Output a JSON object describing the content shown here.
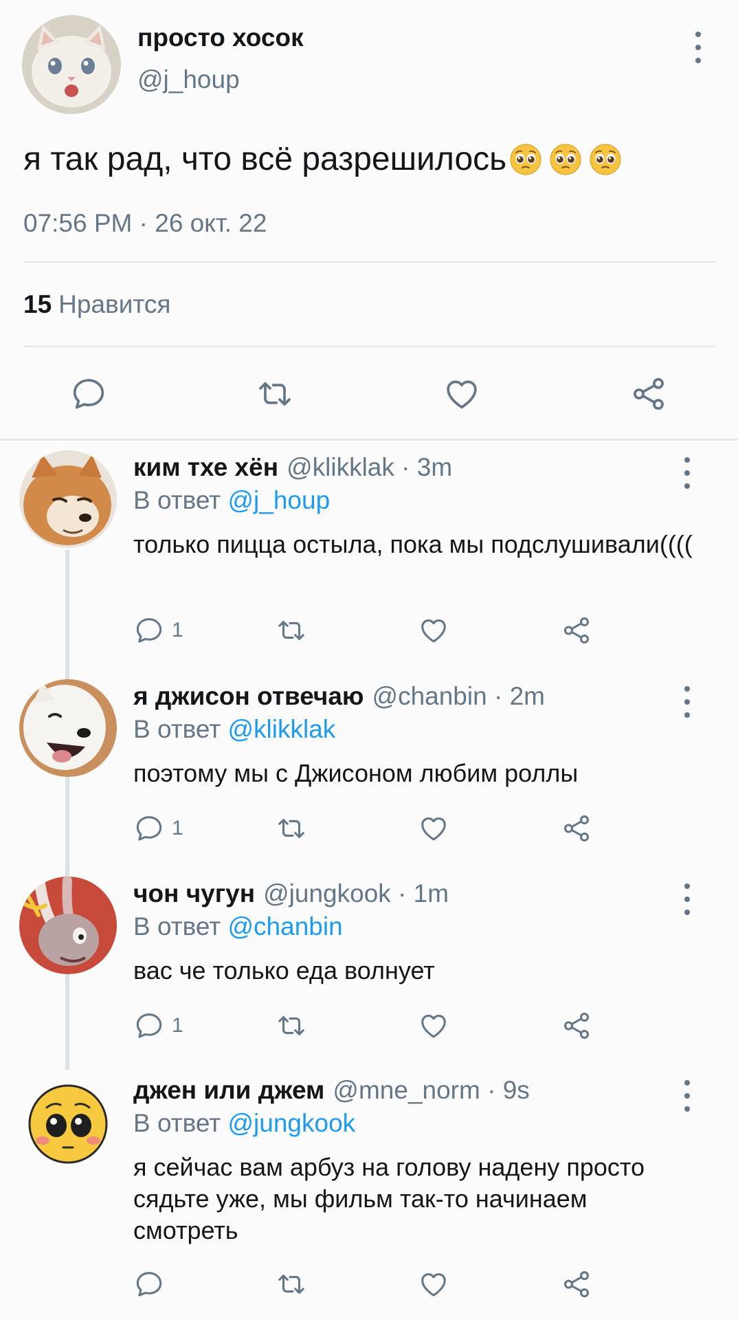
{
  "main_tweet": {
    "display_name": "просто хосок",
    "handle": "@j_houp",
    "text": "я так рад, что всё разрешилось",
    "emoji": [
      "pleading-face",
      "pleading-face",
      "pleading-face"
    ],
    "timestamp": "07:56 PM · 26 окт. 22",
    "like_count": "15",
    "like_label": "Нравится"
  },
  "replies": [
    {
      "display_name": "ким тхе хён",
      "meta": "@klikklak · 3m",
      "reply_prefix": "В ответ",
      "reply_to": "@j_houp",
      "text": "только пицца остыла, пока мы подслушивали((((",
      "reply_count": "1",
      "avatar": "shiba-dog"
    },
    {
      "display_name": "я джисон отвечаю",
      "meta": "@chanbin · 2m",
      "reply_prefix": "В ответ",
      "reply_to": "@klikklak",
      "text": "поэтому мы с Джисоном любим роллы",
      "reply_count": "1",
      "avatar": "white-dog"
    },
    {
      "display_name": "чон чугун",
      "meta": "@jungkook · 1m",
      "reply_prefix": "В ответ",
      "reply_to": "@chanbin",
      "text": "вас че только еда волнует",
      "reply_count": "1",
      "avatar": "bunny-cartoon"
    },
    {
      "display_name": "джен или джем",
      "meta": "@mne_norm · 9s",
      "reply_prefix": "В ответ",
      "reply_to": "@jungkook",
      "text": "я сейчас вам арбуз на голову надену просто сядьте уже, мы фильм так-то начинаем смотреть",
      "reply_count": "",
      "avatar": "pleading-emoji"
    }
  ],
  "colors": {
    "text": "#14171a",
    "muted": "#657786",
    "link": "#1d9bf0",
    "divider": "#e3e6e9"
  }
}
